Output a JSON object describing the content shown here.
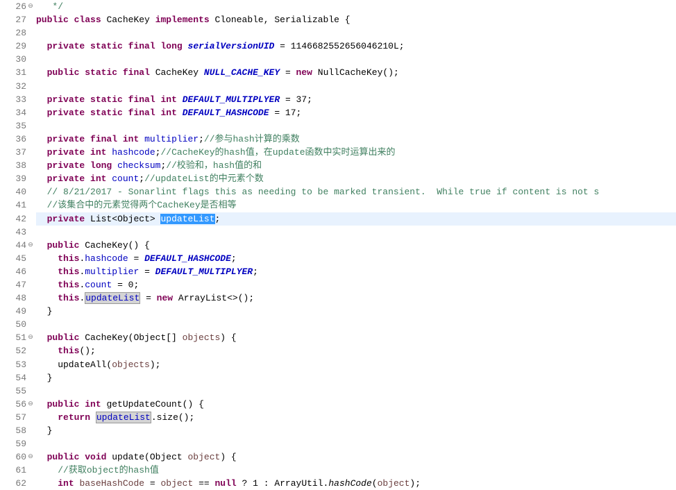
{
  "lines": [
    {
      "n": 26,
      "mk": "⊖",
      "html": "   <span class='comment'>*/</span>"
    },
    {
      "n": 27,
      "mk": "",
      "html": "<span class='kw'>public</span> <span class='kw'>class</span> <span class='type'>CacheKey</span> <span class='kw'>implements</span> <span class='type'>Cloneable</span>, <span class='type'>Serializable</span> {"
    },
    {
      "n": 28,
      "mk": "",
      "html": ""
    },
    {
      "n": 29,
      "mk": "",
      "html": "  <span class='kw'>private</span> <span class='kw'>static</span> <span class='kw'>final</span> <span class='kw'>long</span> <span class='field-static'>serialVersionUID</span> = 1146682552656046210L;"
    },
    {
      "n": 30,
      "mk": "",
      "html": ""
    },
    {
      "n": 31,
      "mk": "",
      "html": "  <span class='kw'>public</span> <span class='kw'>static</span> <span class='kw'>final</span> <span class='type'>CacheKey</span> <span class='field-static'>NULL_CACHE_KEY</span> = <span class='kw'>new</span> <span class='type'>NullCacheKey</span>();"
    },
    {
      "n": 32,
      "mk": "",
      "html": ""
    },
    {
      "n": 33,
      "mk": "",
      "html": "  <span class='kw'>private</span> <span class='kw'>static</span> <span class='kw'>final</span> <span class='kw'>int</span> <span class='field-static'>DEFAULT_MULTIPLYER</span> = 37;"
    },
    {
      "n": 34,
      "mk": "",
      "html": "  <span class='kw'>private</span> <span class='kw'>static</span> <span class='kw'>final</span> <span class='kw'>int</span> <span class='field-static'>DEFAULT_HASHCODE</span> = 17;"
    },
    {
      "n": 35,
      "mk": "",
      "html": ""
    },
    {
      "n": 36,
      "mk": "",
      "html": "  <span class='kw'>private</span> <span class='kw'>final</span> <span class='kw'>int</span> <span class='field'>multiplier</span>;<span class='comment'>//参与hash计算的乘数</span>"
    },
    {
      "n": 37,
      "mk": "",
      "html": "  <span class='kw'>private</span> <span class='kw'>int</span> <span class='field'>hashcode</span>;<span class='comment'>//CacheKey的hash值，在update函数中实时运算出来的</span>"
    },
    {
      "n": 38,
      "mk": "",
      "html": "  <span class='kw'>private</span> <span class='kw'>long</span> <span class='field'>checksum</span>;<span class='comment'>//校验和，hash值的和</span>"
    },
    {
      "n": 39,
      "mk": "",
      "html": "  <span class='kw'>private</span> <span class='kw'>int</span> <span class='field'>count</span>;<span class='comment'>//updateList的中元素个数</span>"
    },
    {
      "n": 40,
      "mk": "",
      "html": "  <span class='comment'>// 8/21/2017 - Sonarlint flags this as needing to be marked transient.  While true if content is not s</span>"
    },
    {
      "n": 41,
      "mk": "",
      "html": "  <span class='comment'>//该集合中的元素觉得两个CacheKey是否相等</span>"
    },
    {
      "n": 42,
      "mk": "",
      "hl": true,
      "html": "  <span class='kw'>private</span> <span class='type'>List</span>&lt;<span class='type'>Object</span>&gt; <span class='sel'>updateList</span>;"
    },
    {
      "n": 43,
      "mk": "",
      "html": ""
    },
    {
      "n": 44,
      "mk": "⊖",
      "html": "  <span class='kw'>public</span> CacheKey() {"
    },
    {
      "n": 45,
      "mk": "",
      "html": "    <span class='this'>this</span>.<span class='field'>hashcode</span> = <span class='field-static'>DEFAULT_HASHCODE</span>;"
    },
    {
      "n": 46,
      "mk": "",
      "html": "    <span class='this'>this</span>.<span class='field'>multiplier</span> = <span class='field-static'>DEFAULT_MULTIPLYER</span>;"
    },
    {
      "n": 47,
      "mk": "",
      "html": "    <span class='this'>this</span>.<span class='field'>count</span> = 0;"
    },
    {
      "n": 48,
      "mk": "",
      "html": "    <span class='this'>this</span>.<span class='occur field'>updateList</span> = <span class='kw'>new</span> <span class='type'>ArrayList</span>&lt;&gt;();"
    },
    {
      "n": 49,
      "mk": "",
      "html": "  }"
    },
    {
      "n": 50,
      "mk": "",
      "html": ""
    },
    {
      "n": 51,
      "mk": "⊖",
      "html": "  <span class='kw'>public</span> CacheKey(<span class='type'>Object</span>[] <span style='color:#6a3e3e'>objects</span>) {"
    },
    {
      "n": 52,
      "mk": "",
      "html": "    <span class='this'>this</span>();"
    },
    {
      "n": 53,
      "mk": "",
      "html": "    updateAll(<span style='color:#6a3e3e'>objects</span>);"
    },
    {
      "n": 54,
      "mk": "",
      "html": "  }"
    },
    {
      "n": 55,
      "mk": "",
      "html": ""
    },
    {
      "n": 56,
      "mk": "⊖",
      "html": "  <span class='kw'>public</span> <span class='kw'>int</span> getUpdateCount() {"
    },
    {
      "n": 57,
      "mk": "",
      "html": "    <span class='kw'>return</span> <span class='occur field'>updateList</span>.size();"
    },
    {
      "n": 58,
      "mk": "",
      "html": "  }"
    },
    {
      "n": 59,
      "mk": "",
      "html": ""
    },
    {
      "n": 60,
      "mk": "⊖",
      "html": "  <span class='kw'>public</span> <span class='kw'>void</span> update(<span class='type'>Object</span> <span style='color:#6a3e3e'>object</span>) {"
    },
    {
      "n": 61,
      "mk": "",
      "html": "    <span class='comment'>//获取object的hash值</span>"
    },
    {
      "n": 62,
      "mk": "",
      "html": "    <span class='kw'>int</span> <span style='color:#6a3e3e'>baseHashCode</span> = <span style='color:#6a3e3e'>object</span> == <span class='kw'>null</span> ? 1 : <span class='type'>ArrayUtil</span>.<span class='static-method'>hashCode</span>(<span style='color:#6a3e3e'>object</span>);"
    }
  ]
}
